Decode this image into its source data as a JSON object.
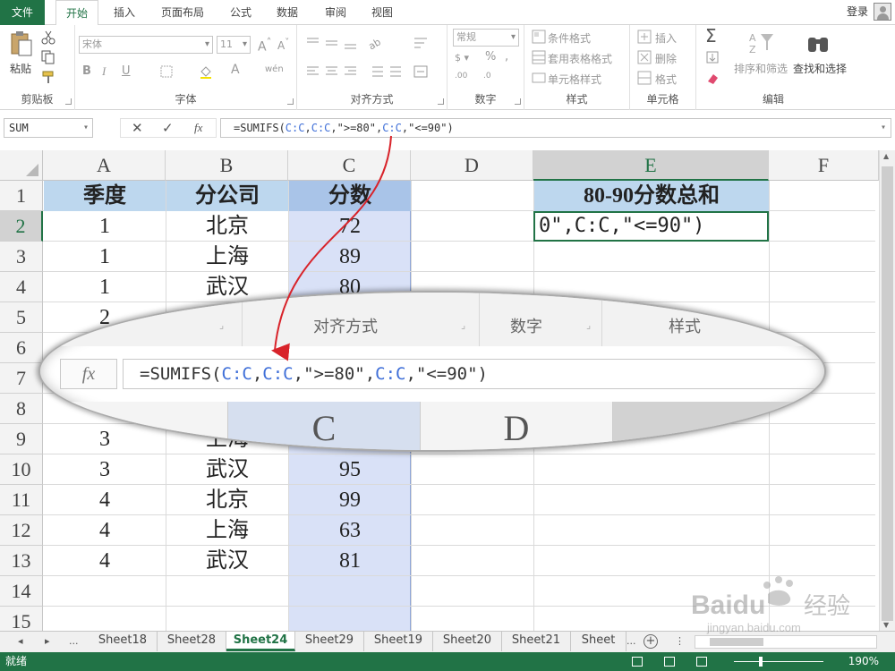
{
  "tabs": {
    "file": "文件",
    "home": "开始",
    "insert": "插入",
    "page_layout": "页面布局",
    "formulas": "公式",
    "data": "数据",
    "review": "审阅",
    "view": "视图",
    "login": "登录"
  },
  "ribbon": {
    "paste": "粘贴",
    "clipboard": "剪贴板",
    "font_name": "宋体",
    "font_size": "11",
    "font": "字体",
    "alignment": "对齐方式",
    "number_format": "常规",
    "number": "数字",
    "conditional_format": "条件格式",
    "table_format": "套用表格格式",
    "cell_styles": "单元格样式",
    "styles": "样式",
    "insert": "插入",
    "delete": "删除",
    "format": "格式",
    "cells": "单元格",
    "sort_filter": "排序和筛选",
    "find_select": "查找和选择",
    "editing": "编辑"
  },
  "formula_bar": {
    "name_box": "SUM",
    "fx": "fx",
    "f_prefix": "=SUMIFS(",
    "f_ref1": "C:C",
    "f_comma1": ",",
    "f_ref2": "C:C",
    "f_mid": ",\">=80\",",
    "f_ref3": "C:C",
    "f_suffix": ",\"<=90\")"
  },
  "grid": {
    "columns": [
      "A",
      "B",
      "C",
      "D",
      "E",
      "F"
    ],
    "rows": [
      "1",
      "2",
      "3",
      "4",
      "5",
      "6",
      "7",
      "8",
      "9",
      "10",
      "11",
      "12",
      "13",
      "14",
      "15"
    ],
    "header": {
      "a": "季度",
      "b": "分公司",
      "c": "分数",
      "e": "80-90分数总和"
    },
    "data_rows": [
      {
        "row": 2,
        "a": "1",
        "b": "北京",
        "c": "72"
      },
      {
        "row": 3,
        "a": "1",
        "b": "上海",
        "c": "89"
      },
      {
        "row": 4,
        "a": "1",
        "b": "武汉",
        "c": "80"
      },
      {
        "row": 5,
        "a": "2",
        "b": "",
        "c": ""
      },
      {
        "row": 9,
        "a": "3",
        "b": "上海",
        "c": ""
      },
      {
        "row": 10,
        "a": "3",
        "b": "武汉",
        "c": "95"
      },
      {
        "row": 11,
        "a": "4",
        "b": "北京",
        "c": "99"
      },
      {
        "row": 12,
        "a": "4",
        "b": "上海",
        "c": "63"
      },
      {
        "row": 13,
        "a": "4",
        "b": "武汉",
        "c": "81"
      }
    ],
    "active_cell_text": "0\",C:C,\"<=90\")"
  },
  "zoom": {
    "alignment": "对齐方式",
    "number": "数字",
    "styles": "样式",
    "fx": "fx",
    "col_c": "C",
    "col_d": "D"
  },
  "sheets": [
    "Sheet18",
    "Sheet28",
    "Sheet24",
    "Sheet29",
    "Sheet19",
    "Sheet20",
    "Sheet21",
    "Sheet"
  ],
  "sheet_nav": {
    "ellipsis": "...",
    "more": "..."
  },
  "status": {
    "text": "就绪",
    "zoom": "190%"
  },
  "colors": {
    "accent": "#217346",
    "ref": "#3f6fd8",
    "header_fill": "#bdd7ee",
    "selection": "#d9e1f7"
  },
  "watermark": {
    "logo": "Baidu",
    "brand": "经验",
    "url": "jingyan.baidu.com"
  }
}
